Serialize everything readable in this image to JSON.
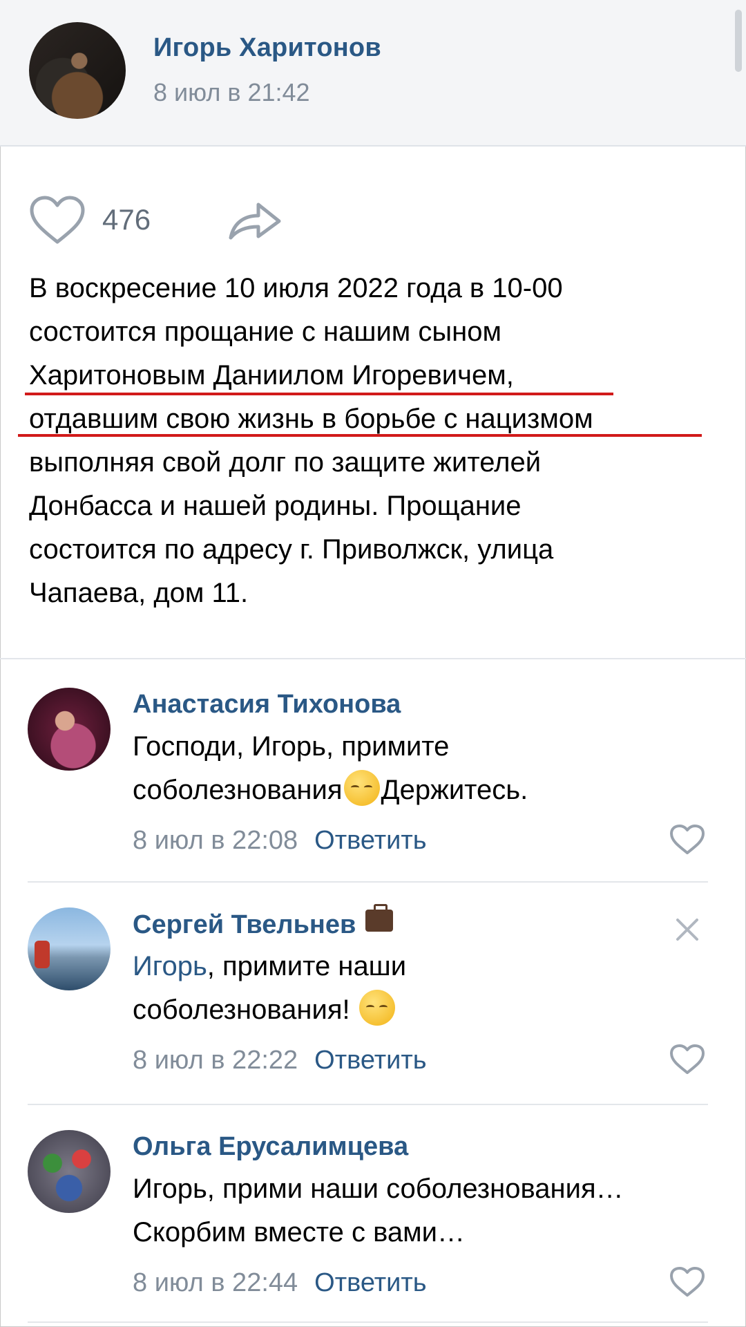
{
  "post": {
    "author": "Игорь Харитонов",
    "date": "8 июл в 21:42",
    "likes": "476",
    "text_lines": [
      "В воскресение 10 июля 2022 года в 10-00",
      "состоится прощание с нашим сыном",
      "Харитоновым Даниилом Игоревичем,",
      "отдавшим свою жизнь в борьбе с нацизмом",
      "выполняя свой долг по защите жителей",
      "Донбасса и нашей родины. Прощание",
      "состоится по адресу г. Приволжск, улица",
      "Чапаева, дом 11."
    ]
  },
  "comments": [
    {
      "name": "Анастасия Тихонова",
      "line1": "Господи, Игорь, примите",
      "line2_a": "соболезнования",
      "line2_b": "Держитесь.",
      "time": "8 июл в 22:08",
      "reply": "Ответить"
    },
    {
      "name": "Сергей Твельнев",
      "mention": "Игорь",
      "line1_rest": ", примите наши",
      "line2": "соболезнования!",
      "time": "8 июл в 22:22",
      "reply": "Ответить"
    },
    {
      "name": "Ольга Ерусалимцева",
      "line1": "Игорь, прими наши соболезнования…",
      "line2": "Скорбим вместе с вами…",
      "time": "8 июл в 22:44",
      "reply": "Ответить"
    }
  ],
  "colors": {
    "link": "#2a5885",
    "meta": "#818c99",
    "underline": "#d11a1a"
  },
  "icons": [
    "heart-icon",
    "share-icon",
    "close-icon",
    "briefcase-icon",
    "pensive-emoji-icon"
  ]
}
